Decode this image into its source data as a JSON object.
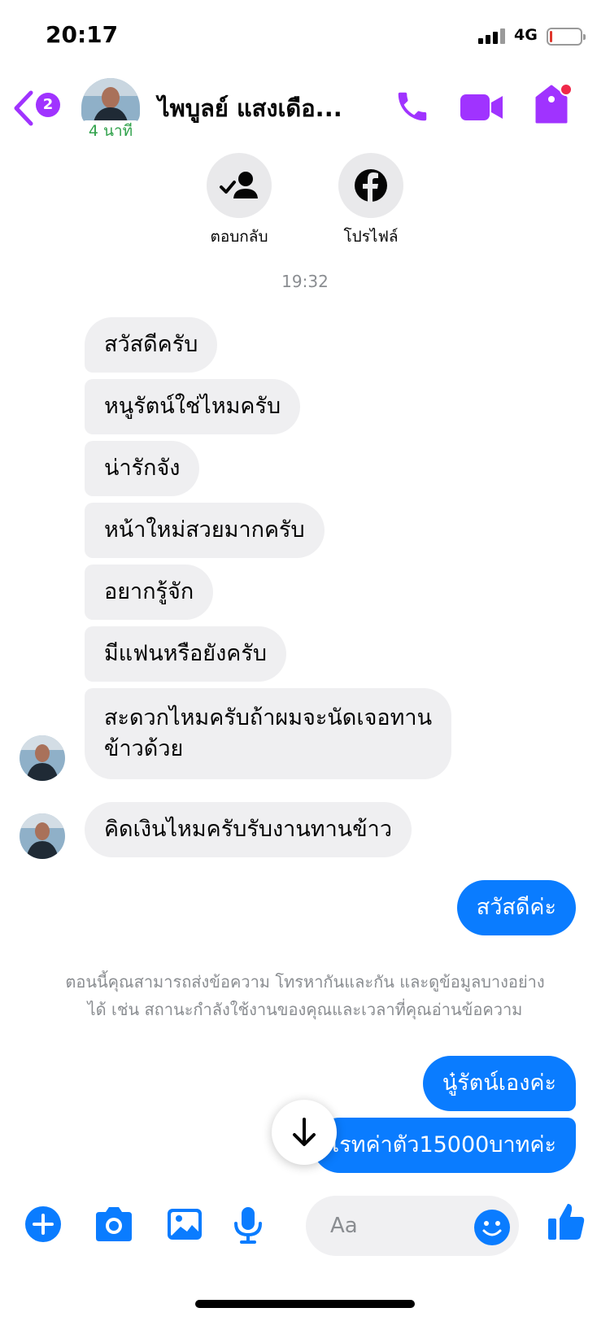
{
  "status_bar": {
    "time": "20:17",
    "network": "4G"
  },
  "header": {
    "unread_count": "2",
    "active_status": "4 นาที",
    "contact_name": "ไพบูลย์ แสงเดือ..."
  },
  "quick_actions": [
    {
      "label": "ตอบกลับ",
      "icon": "follow-back-icon"
    },
    {
      "label": "โปรไฟล์",
      "icon": "facebook-icon"
    }
  ],
  "timestamp": "19:32",
  "messages_incoming": [
    {
      "text": "สวัสดีครับ"
    },
    {
      "text": "หนูรัตน์ใช่ไหมครับ"
    },
    {
      "text": "น่ารักจัง"
    },
    {
      "text": "หน้าใหม่สวยมากครับ"
    },
    {
      "text": "อยากรู้จัก"
    },
    {
      "text": "มีแฟนหรือยังครับ"
    },
    {
      "line1": "สะดวกไหมครับถ้าผมจะนัดเจอทาน",
      "line2": "ข้าวด้วย"
    },
    {
      "text": "คิดเงินไหมครับรับงานทานข้าว"
    }
  ],
  "messages_outgoing": [
    {
      "text": "สวัสดีค่ะ"
    },
    {
      "text": "นู๋รัตน์เองค่ะ"
    },
    {
      "text": "เรทค่าตัว15000บาทค่ะ"
    }
  ],
  "info_notice": {
    "line1": "ตอนนี้คุณสามารถส่งข้อความ โทรหากันและกัน และดูข้อมูลบางอย่าง",
    "line2": "ได้ เช่น สถานะกำลังใช้งานของคุณและเวลาที่คุณอ่านข้อความ"
  },
  "composer": {
    "placeholder": "Aa"
  },
  "colors": {
    "accent_purple": "#a033ff",
    "bubble_blue": "#0a7cff",
    "bubble_gray": "#efeff1",
    "active_green": "#31a24c"
  }
}
